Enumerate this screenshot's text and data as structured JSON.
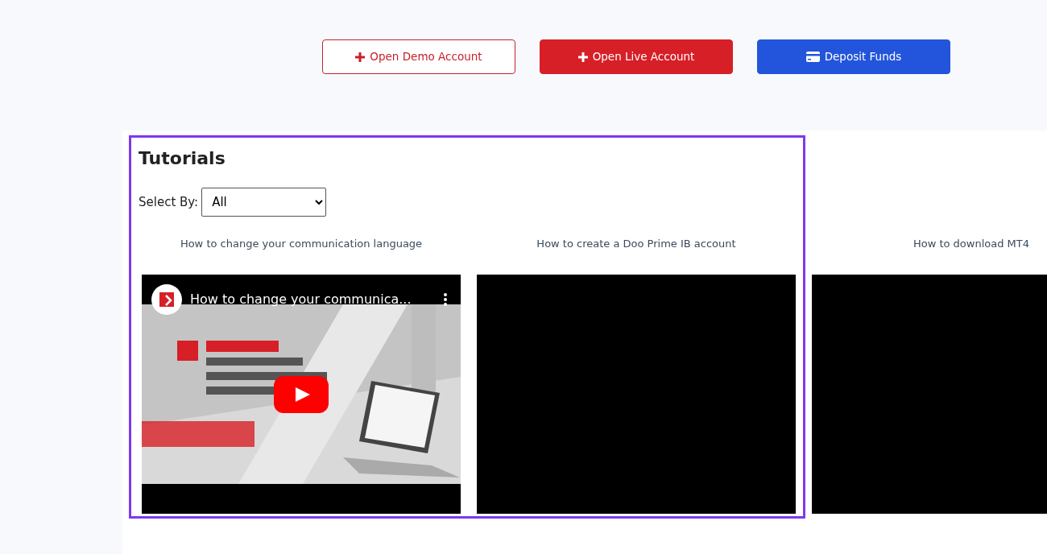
{
  "actions": [
    {
      "label": "Open Demo Account",
      "kind": "outline"
    },
    {
      "label": "Open Live Account",
      "kind": "danger"
    },
    {
      "label": "Deposit Funds",
      "kind": "primary"
    }
  ],
  "tutorials": {
    "title": "Tutorials",
    "filter_label": "Select By:",
    "filter_value": "All",
    "videos": [
      {
        "title": "How to change your communication language",
        "kind": "thumbnail",
        "overlay_title": "How to change your communica..."
      },
      {
        "title": "How to create a Doo Prime IB account",
        "kind": "blank"
      },
      {
        "title": "How to download MT4",
        "kind": "blank"
      }
    ]
  }
}
